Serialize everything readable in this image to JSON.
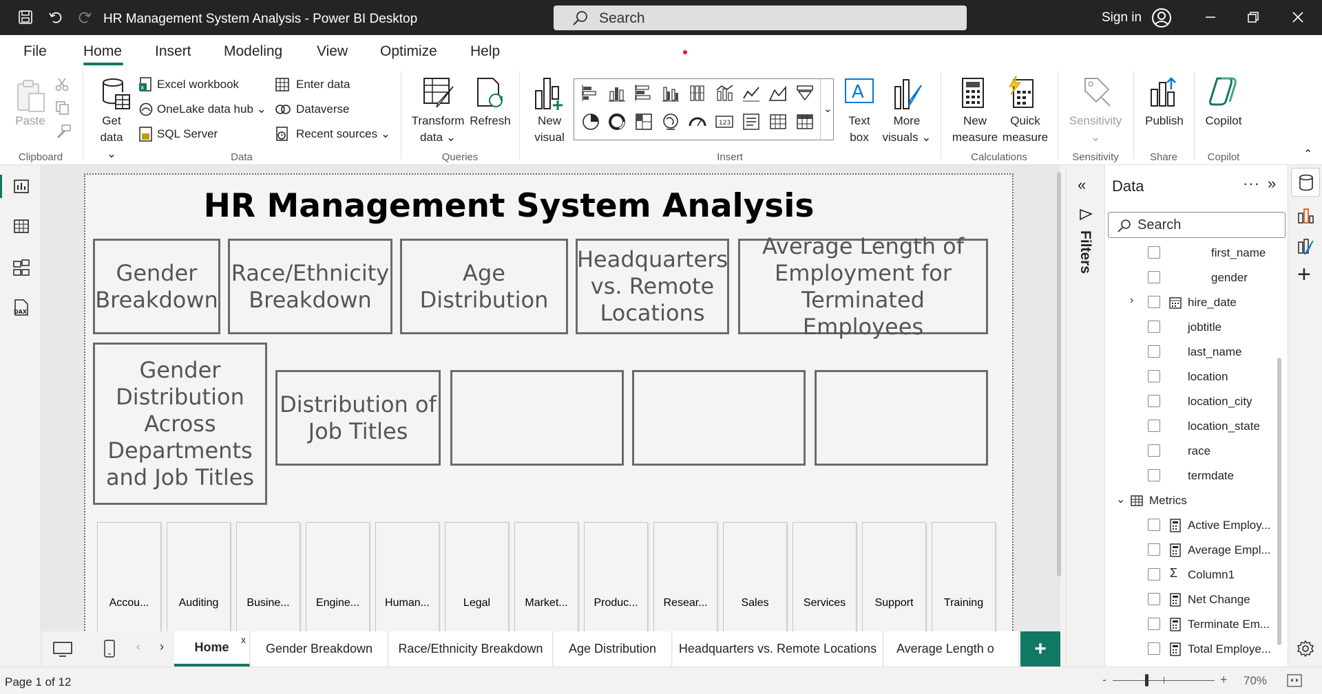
{
  "window": {
    "title": "HR Management System Analysis - Power BI Desktop",
    "search_placeholder": "Search",
    "sign_in": "Sign in"
  },
  "menu": {
    "tabs": [
      "File",
      "Home",
      "Insert",
      "Modeling",
      "View",
      "Optimize",
      "Help"
    ],
    "active": "Home"
  },
  "ribbon": {
    "clipboard": {
      "paste": "Paste",
      "group": "Clipboard"
    },
    "data": {
      "get_data_1": "Get",
      "get_data_2": "data",
      "excel": "Excel workbook",
      "onelake": "OneLake data hub",
      "sql": "SQL Server",
      "enter_data": "Enter data",
      "dataverse": "Dataverse",
      "recent": "Recent sources",
      "group": "Data"
    },
    "queries": {
      "transform_1": "Transform",
      "transform_2": "data",
      "refresh": "Refresh",
      "group": "Queries"
    },
    "insert": {
      "new_visual_1": "New",
      "new_visual_2": "visual",
      "text_box_1": "Text",
      "text_box_2": "box",
      "more_visuals_1": "More",
      "more_visuals_2": "visuals",
      "group": "Insert"
    },
    "calculations": {
      "new_measure_1": "New",
      "new_measure_2": "measure",
      "quick_measure_1": "Quick",
      "quick_measure_2": "measure",
      "group": "Calculations"
    },
    "sensitivity": {
      "label": "Sensitivity",
      "group": "Sensitivity"
    },
    "share": {
      "publish": "Publish",
      "group": "Share"
    },
    "copilot": {
      "label": "Copilot",
      "group": "Copilot"
    }
  },
  "report": {
    "title": "HR Management System Analysis",
    "buttons": [
      "Gender Breakdown",
      "Race/Ethnicity Breakdown",
      "Age Distribution",
      "Headquarters vs. Remote Locations",
      "Average Length of Employment for Terminated Employees",
      "Gender Distribution Across Departments and Job Titles",
      "Distribution of Job Titles"
    ],
    "departments": [
      "Accou...",
      "Auditing",
      "Busine...",
      "Engine...",
      "Human...",
      "Legal",
      "Market...",
      "Produc...",
      "Resear...",
      "Sales",
      "Services",
      "Support",
      "Training"
    ]
  },
  "filters": {
    "label": "Filters"
  },
  "data_pane": {
    "title": "Data",
    "search_placeholder": "Search",
    "fields": [
      "first_name",
      "gender",
      "hire_date",
      "jobtitle",
      "last_name",
      "location",
      "location_city",
      "location_state",
      "race",
      "termdate"
    ],
    "table_name": "Metrics",
    "measures": [
      "Active Employ...",
      "Average Empl...",
      "Column1",
      "Net Change",
      "Terminate Em...",
      "Total Employe..."
    ]
  },
  "page_tabs": {
    "tabs": [
      "Home",
      "Gender Breakdown",
      "Race/Ethnicity Breakdown",
      "Age Distribution",
      "Headquarters vs. Remote Locations",
      "Average Length o"
    ],
    "active": "Home",
    "close_glyph": "x",
    "add_glyph": "+"
  },
  "status": {
    "page": "Page 1 of 12",
    "zoom": "70%",
    "zoom_minus": "-",
    "zoom_plus": "+"
  },
  "colors": {
    "accent": "#117865",
    "titlebar": "#252423"
  }
}
